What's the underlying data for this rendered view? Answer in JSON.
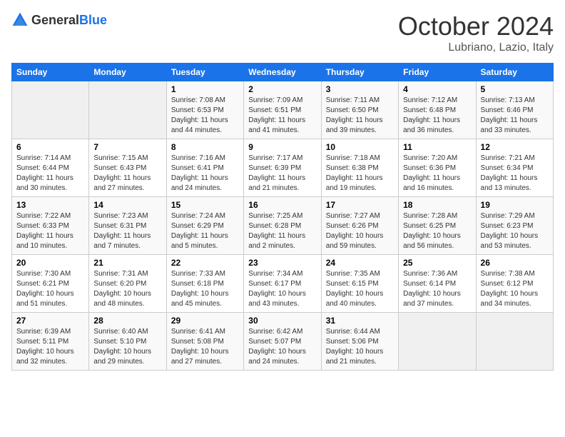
{
  "logo": {
    "general": "General",
    "blue": "Blue"
  },
  "header": {
    "month": "October 2024",
    "location": "Lubriano, Lazio, Italy"
  },
  "weekdays": [
    "Sunday",
    "Monday",
    "Tuesday",
    "Wednesday",
    "Thursday",
    "Friday",
    "Saturday"
  ],
  "weeks": [
    [
      {
        "day": "",
        "info": ""
      },
      {
        "day": "",
        "info": ""
      },
      {
        "day": "1",
        "info": "Sunrise: 7:08 AM\nSunset: 6:53 PM\nDaylight: 11 hours and 44 minutes."
      },
      {
        "day": "2",
        "info": "Sunrise: 7:09 AM\nSunset: 6:51 PM\nDaylight: 11 hours and 41 minutes."
      },
      {
        "day": "3",
        "info": "Sunrise: 7:11 AM\nSunset: 6:50 PM\nDaylight: 11 hours and 39 minutes."
      },
      {
        "day": "4",
        "info": "Sunrise: 7:12 AM\nSunset: 6:48 PM\nDaylight: 11 hours and 36 minutes."
      },
      {
        "day": "5",
        "info": "Sunrise: 7:13 AM\nSunset: 6:46 PM\nDaylight: 11 hours and 33 minutes."
      }
    ],
    [
      {
        "day": "6",
        "info": "Sunrise: 7:14 AM\nSunset: 6:44 PM\nDaylight: 11 hours and 30 minutes."
      },
      {
        "day": "7",
        "info": "Sunrise: 7:15 AM\nSunset: 6:43 PM\nDaylight: 11 hours and 27 minutes."
      },
      {
        "day": "8",
        "info": "Sunrise: 7:16 AM\nSunset: 6:41 PM\nDaylight: 11 hours and 24 minutes."
      },
      {
        "day": "9",
        "info": "Sunrise: 7:17 AM\nSunset: 6:39 PM\nDaylight: 11 hours and 21 minutes."
      },
      {
        "day": "10",
        "info": "Sunrise: 7:18 AM\nSunset: 6:38 PM\nDaylight: 11 hours and 19 minutes."
      },
      {
        "day": "11",
        "info": "Sunrise: 7:20 AM\nSunset: 6:36 PM\nDaylight: 11 hours and 16 minutes."
      },
      {
        "day": "12",
        "info": "Sunrise: 7:21 AM\nSunset: 6:34 PM\nDaylight: 11 hours and 13 minutes."
      }
    ],
    [
      {
        "day": "13",
        "info": "Sunrise: 7:22 AM\nSunset: 6:33 PM\nDaylight: 11 hours and 10 minutes."
      },
      {
        "day": "14",
        "info": "Sunrise: 7:23 AM\nSunset: 6:31 PM\nDaylight: 11 hours and 7 minutes."
      },
      {
        "day": "15",
        "info": "Sunrise: 7:24 AM\nSunset: 6:29 PM\nDaylight: 11 hours and 5 minutes."
      },
      {
        "day": "16",
        "info": "Sunrise: 7:25 AM\nSunset: 6:28 PM\nDaylight: 11 hours and 2 minutes."
      },
      {
        "day": "17",
        "info": "Sunrise: 7:27 AM\nSunset: 6:26 PM\nDaylight: 10 hours and 59 minutes."
      },
      {
        "day": "18",
        "info": "Sunrise: 7:28 AM\nSunset: 6:25 PM\nDaylight: 10 hours and 56 minutes."
      },
      {
        "day": "19",
        "info": "Sunrise: 7:29 AM\nSunset: 6:23 PM\nDaylight: 10 hours and 53 minutes."
      }
    ],
    [
      {
        "day": "20",
        "info": "Sunrise: 7:30 AM\nSunset: 6:21 PM\nDaylight: 10 hours and 51 minutes."
      },
      {
        "day": "21",
        "info": "Sunrise: 7:31 AM\nSunset: 6:20 PM\nDaylight: 10 hours and 48 minutes."
      },
      {
        "day": "22",
        "info": "Sunrise: 7:33 AM\nSunset: 6:18 PM\nDaylight: 10 hours and 45 minutes."
      },
      {
        "day": "23",
        "info": "Sunrise: 7:34 AM\nSunset: 6:17 PM\nDaylight: 10 hours and 43 minutes."
      },
      {
        "day": "24",
        "info": "Sunrise: 7:35 AM\nSunset: 6:15 PM\nDaylight: 10 hours and 40 minutes."
      },
      {
        "day": "25",
        "info": "Sunrise: 7:36 AM\nSunset: 6:14 PM\nDaylight: 10 hours and 37 minutes."
      },
      {
        "day": "26",
        "info": "Sunrise: 7:38 AM\nSunset: 6:12 PM\nDaylight: 10 hours and 34 minutes."
      }
    ],
    [
      {
        "day": "27",
        "info": "Sunrise: 6:39 AM\nSunset: 5:11 PM\nDaylight: 10 hours and 32 minutes."
      },
      {
        "day": "28",
        "info": "Sunrise: 6:40 AM\nSunset: 5:10 PM\nDaylight: 10 hours and 29 minutes."
      },
      {
        "day": "29",
        "info": "Sunrise: 6:41 AM\nSunset: 5:08 PM\nDaylight: 10 hours and 27 minutes."
      },
      {
        "day": "30",
        "info": "Sunrise: 6:42 AM\nSunset: 5:07 PM\nDaylight: 10 hours and 24 minutes."
      },
      {
        "day": "31",
        "info": "Sunrise: 6:44 AM\nSunset: 5:06 PM\nDaylight: 10 hours and 21 minutes."
      },
      {
        "day": "",
        "info": ""
      },
      {
        "day": "",
        "info": ""
      }
    ]
  ]
}
